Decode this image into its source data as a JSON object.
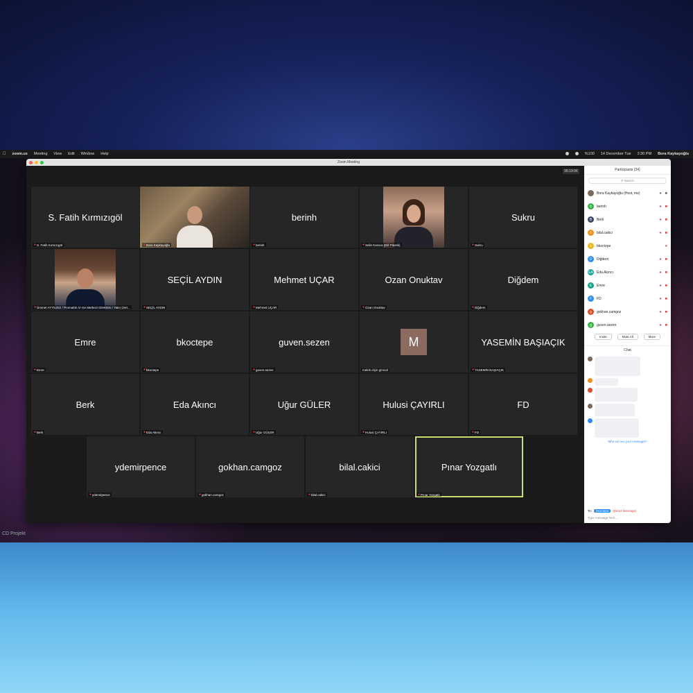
{
  "menubar": {
    "app": "zoom.us",
    "menus": [
      "Meeting",
      "View",
      "Edit",
      "Window",
      "Help"
    ],
    "battery": "%100",
    "date": "14 December Tue",
    "time": "2:30 PM",
    "user": "Bora Kaykayoğlu"
  },
  "desktop": {
    "watermark": "CD Projekt"
  },
  "window": {
    "title": "Zoom Meeting",
    "timer": "05:19:06"
  },
  "tiles": [
    {
      "name": "S. Fatih Kırmızıgöl",
      "label": "S. Fatih Kırmızıgöl"
    },
    {
      "name": "",
      "label": "Bora Kaykayoğlu"
    },
    {
      "name": "berinh",
      "label": "berinh"
    },
    {
      "name": "",
      "label": "Selin Karaca (Elif Plastik)"
    },
    {
      "name": "Sukru",
      "label": "Sukru"
    },
    {
      "name": "",
      "label": "Ümmet AYYILDIZ / Promatlık Ar-Ge Merkezi Direktörü / Yalın Üret..."
    },
    {
      "name": "SEÇİL AYDIN",
      "label": "SEÇİL AYDIN"
    },
    {
      "name": "Mehmet UÇAR",
      "label": "Mehmet UÇAR"
    },
    {
      "name": "Ozan Onuktav",
      "label": "Ozan Onuktav"
    },
    {
      "name": "Diğdem",
      "label": "Diğdem"
    },
    {
      "name": "Emre",
      "label": "Emre"
    },
    {
      "name": "bkoctepe",
      "label": "bkoctepe"
    },
    {
      "name": "guven.sezen",
      "label": "guven.sezen"
    },
    {
      "name": "M",
      "label": "melek elçin gimcal"
    },
    {
      "name": "YASEMİN BAŞIAÇIK",
      "label": "YASEMİN BAŞIAÇIK"
    },
    {
      "name": "Berk",
      "label": "Berk"
    },
    {
      "name": "Eda Akıncı",
      "label": "Eda Akıncı"
    },
    {
      "name": "Uğur GÜLER",
      "label": "Uğur GÜLER"
    },
    {
      "name": "Hulusi ÇAYIRLI",
      "label": "Hulusi ÇAYIRLI"
    },
    {
      "name": "FD",
      "label": "FD"
    },
    {
      "name": "ydemirpence",
      "label": "ydemirpence"
    },
    {
      "name": "gokhan.camgoz",
      "label": "gokhan.camgoz"
    },
    {
      "name": "bilal.cakici",
      "label": "bilal.cakici"
    },
    {
      "name": "Pınar Yozgatlı",
      "label": "Pınar Yozgatlı"
    }
  ],
  "participants": {
    "title": "Participants (24)",
    "search_placeholder": "Search",
    "list": [
      {
        "name": "Bora Kaykayoğlu (Host, me)",
        "initial": "",
        "color": "#7a6a5c"
      },
      {
        "name": "berinh",
        "initial": "b",
        "color": "#3bb34a"
      },
      {
        "name": "Berk",
        "initial": "B",
        "color": "#3a4a66"
      },
      {
        "name": "bilal.cakici",
        "initial": "b",
        "color": "#f0901e"
      },
      {
        "name": "bkoctepe",
        "initial": "b",
        "color": "#f0b21e"
      },
      {
        "name": "Diğdem",
        "initial": "D",
        "color": "#2d8cff"
      },
      {
        "name": "Eda Akıncı",
        "initial": "EA",
        "color": "#1aa39a"
      },
      {
        "name": "Emre",
        "initial": "E",
        "color": "#1aa38a"
      },
      {
        "name": "FD",
        "initial": "F",
        "color": "#2d8cff"
      },
      {
        "name": "gokhan.camgoz",
        "initial": "g",
        "color": "#e04a2a"
      },
      {
        "name": "guven.sezen",
        "initial": "g",
        "color": "#3bb34a"
      }
    ],
    "buttons": {
      "invite": "Invite",
      "mute_all": "Mute All",
      "more": "More"
    }
  },
  "chat": {
    "title": "Chat",
    "to_label": "To:",
    "recipient": "bkoctepe",
    "direct": "(Direct Message)",
    "placeholder": "Type message here...",
    "who_can_see": "Who can see your messages?"
  }
}
